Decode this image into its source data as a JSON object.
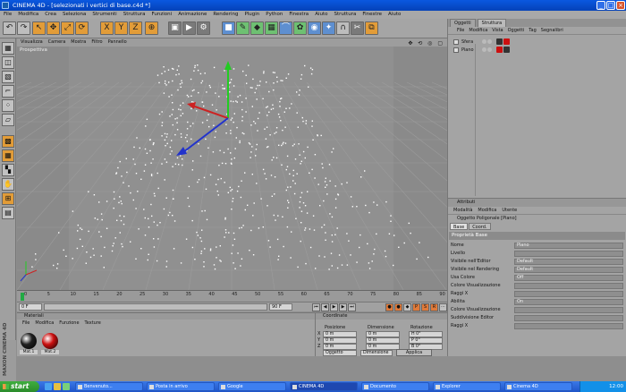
{
  "window": {
    "title": "CINEMA 4D - [selezionati i vertici di base.c4d *]",
    "controls": [
      "_",
      "□",
      "×"
    ]
  },
  "menubar": [
    "File",
    "Modifica",
    "Crea",
    "Seleziona",
    "Strumenti",
    "Struttura",
    "Funzioni",
    "Animazione",
    "Rendering",
    "Plugin",
    "Python",
    "Finestra",
    "Aiuto",
    "Struttura",
    "Finestre",
    "Aiuto"
  ],
  "toolbar": {
    "icons": [
      "undo-icon",
      "redo-icon",
      "select-icon",
      "move-icon",
      "scale-icon",
      "rotate-icon",
      "x-axis-icon",
      "y-axis-icon",
      "z-axis-icon",
      "coord-icon",
      "render-view-icon",
      "render-icon",
      "render-settings-icon",
      "cube-icon",
      "pen-icon",
      "subdivision-icon",
      "array-icon",
      "deformer-icon",
      "scene-icon",
      "camera-icon",
      "light-icon",
      "magnet-icon",
      "knife-icon",
      "plugin-icon"
    ],
    "axis_labels": [
      "X",
      "Y",
      "Z"
    ]
  },
  "left_tools": [
    "model-icon",
    "object-icon",
    "texture-icon",
    "axis-icon",
    "points-icon",
    "edges-icon",
    "polygons-icon",
    "grid-icon",
    "checker-icon",
    "sculpt-icon",
    "snap-icon",
    "workplane-icon"
  ],
  "viewport": {
    "menu": [
      "Visualizza",
      "Camera",
      "Mostra",
      "Filtro",
      "Pannello"
    ],
    "label": "Prospettiva",
    "nav_icons": "✥ ⟲ ◎ ▢"
  },
  "timeline": {
    "ticks": [
      "0",
      "5",
      "10",
      "15",
      "20",
      "25",
      "30",
      "35",
      "40",
      "45",
      "50",
      "55",
      "60",
      "65",
      "70",
      "75",
      "80",
      "85",
      "90"
    ],
    "current_frame": "0 F",
    "start_field": "0 F",
    "end_field": "90 F",
    "current_field": "0 F"
  },
  "materials": {
    "title": "Materiali",
    "menu": [
      "File",
      "Modifica",
      "Funzione",
      "Texture"
    ],
    "items": [
      {
        "label": "Mat.1",
        "color": "#202020"
      },
      {
        "label": "Mat.2",
        "color": "#cc1010"
      }
    ]
  },
  "coordinates": {
    "title": "Coordinate",
    "headers": [
      "Posizione",
      "Dimensione",
      "Rotazione"
    ],
    "rows": [
      {
        "axis": "X",
        "pos": "0 m",
        "size": "0 m",
        "rot": "H 0°"
      },
      {
        "axis": "Y",
        "pos": "0 m",
        "size": "0 m",
        "rot": "P 0°"
      },
      {
        "axis": "Z",
        "pos": "0 m",
        "size": "0 m",
        "rot": "B 0°"
      }
    ],
    "mode_left": "Oggetto",
    "mode_mid": "Dimensione",
    "apply": "Applica"
  },
  "object_manager": {
    "tabs": [
      "Oggetti",
      "Struttura"
    ],
    "menu": [
      "File",
      "Modifica",
      "Vista",
      "Oggetti",
      "Tag",
      "Segnalibri"
    ],
    "objects": [
      {
        "name": "Sfera",
        "dot": "#bbbbbb",
        "tag1": "#333333",
        "tag2": "#cc1010"
      },
      {
        "name": "Piano",
        "dot": "#bbbbbb",
        "tag1": "#cc1010",
        "tag2": "#333333"
      }
    ]
  },
  "attribute_manager": {
    "title": "Attributi",
    "menu": [
      "Modalità",
      "Modifica",
      "Utente"
    ],
    "object_line": "Oggetto Poligonale [Piano]",
    "tabs": [
      "Base",
      "Coord."
    ],
    "section": "Proprietà Base",
    "rows": [
      {
        "label": "Nome",
        "value": "Piano"
      },
      {
        "label": "Livello",
        "value": ""
      },
      {
        "label": "Visibile nell'Editor",
        "value": "Default"
      },
      {
        "label": "Visibile nel Rendering",
        "value": "Default"
      },
      {
        "label": "Usa Colore",
        "value": "Off"
      },
      {
        "label": "Colore Visualizzazione",
        "value": ""
      },
      {
        "label": "Raggi X",
        "value": ""
      },
      {
        "label": "Abilita",
        "value": "On"
      },
      {
        "label": "Colore Visualizzazione",
        "value": ""
      },
      {
        "label": "Suddivisione Editor",
        "value": ""
      },
      {
        "label": "Raggi X",
        "value": ""
      }
    ]
  },
  "branding": "MAXON CINEMA 4D",
  "taskbar": {
    "start": "start",
    "tasks": [
      {
        "label": "Benvenuto...",
        "active": false
      },
      {
        "label": "Posta in arrivo",
        "active": false
      },
      {
        "label": "Google",
        "active": false
      },
      {
        "label": "CINEMA 4D",
        "active": true
      },
      {
        "label": "Documento",
        "active": false
      },
      {
        "label": "Explorer",
        "active": false
      },
      {
        "label": "Cinema 4D",
        "active": false
      }
    ],
    "clock": "12:00"
  },
  "accent_colors": {
    "title_blue": "#0a58e0",
    "y_axis": "#22cc22",
    "x_axis": "#cc2222",
    "z_axis": "#2233cc",
    "points": "#ffffff"
  }
}
